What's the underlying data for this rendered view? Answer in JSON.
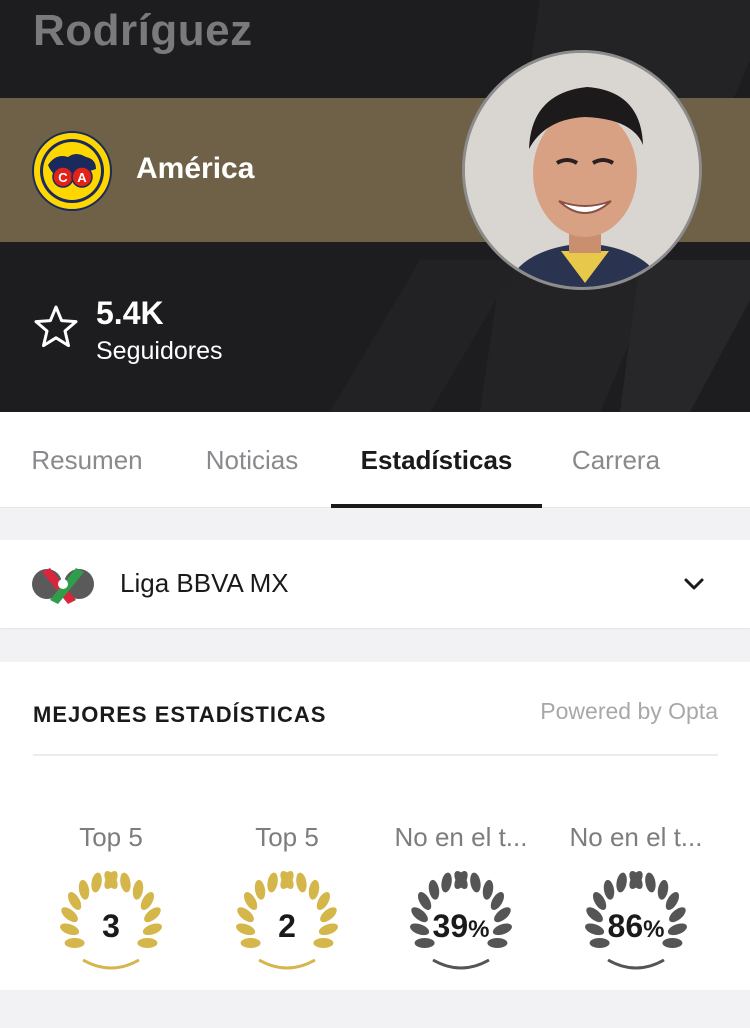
{
  "header": {
    "player_name": "Rodríguez",
    "club": {
      "name": "América",
      "badge_icon": "club-america-crest-icon"
    },
    "followers": {
      "count": "5.4K",
      "label": "Seguidores",
      "icon": "star-outline-icon"
    },
    "colors": {
      "background": "#1d1d1f",
      "stripe": "#6e6148"
    }
  },
  "tabs": [
    {
      "label": "Resumen",
      "active": false
    },
    {
      "label": "Noticias",
      "active": false
    },
    {
      "label": "Estadísticas",
      "active": true
    },
    {
      "label": "Carrera",
      "active": false
    }
  ],
  "league": {
    "name": "Liga BBVA MX",
    "icon": "liga-mx-logo-icon",
    "chevron_icon": "chevron-down-icon"
  },
  "best_stats": {
    "title": "MEJORES ESTADÍSTICAS",
    "powered_by": "Powered by Opta",
    "items": [
      {
        "label": "Top 5",
        "value": "3",
        "suffix": "",
        "laurel_color": "#d4b64a"
      },
      {
        "label": "Top 5",
        "value": "2",
        "suffix": "",
        "laurel_color": "#d4b64a"
      },
      {
        "label": "No en el t...",
        "value": "39",
        "suffix": "%",
        "laurel_color": "#555555"
      },
      {
        "label": "No en el t...",
        "value": "86",
        "suffix": "%",
        "laurel_color": "#555555"
      }
    ]
  }
}
